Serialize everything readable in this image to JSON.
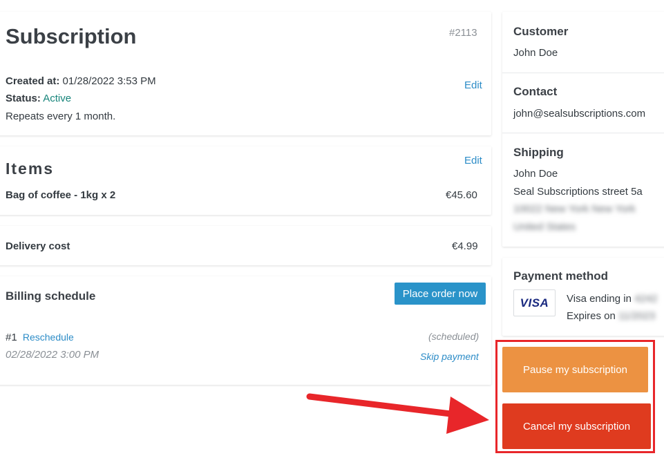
{
  "subscription": {
    "title": "Subscription",
    "number": "#2113",
    "created_label": "Created at:",
    "created_value": "01/28/2022 3:53 PM",
    "status_label": "Status:",
    "status_value": "Active",
    "repeats": "Repeats every 1 month.",
    "edit_label": "Edit"
  },
  "items": {
    "title": "Items",
    "edit_label": "Edit",
    "rows": [
      {
        "name": "Bag of coffee - 1kg x 2",
        "price": "€45.60"
      }
    ]
  },
  "delivery": {
    "label": "Delivery cost",
    "value": "€4.99"
  },
  "billing": {
    "title": "Billing schedule",
    "place_order_label": "Place order now",
    "entries": [
      {
        "index": "#1",
        "reschedule_label": "Reschedule",
        "state": "(scheduled)",
        "date": "02/28/2022 3:00 PM",
        "skip_label": "Skip payment"
      }
    ]
  },
  "customer": {
    "title": "Customer",
    "name": "John Doe"
  },
  "contact": {
    "title": "Contact",
    "email": "john@sealsubscriptions.com"
  },
  "shipping": {
    "title": "Shipping",
    "name": "John Doe",
    "street": "Seal Subscriptions street 5a",
    "city_line": "10022 New York New York",
    "country": "United States"
  },
  "payment": {
    "title": "Payment method",
    "brand": "VISA",
    "ending_label": "Visa ending in",
    "ending_value": "4242",
    "expires_label": "Expires on",
    "expires_value": "11/2023"
  },
  "actions": {
    "pause_label": "Pause my subscription",
    "cancel_label": "Cancel my subscription"
  },
  "colors": {
    "pause": "#ec9242",
    "cancel": "#df3b1f",
    "highlight": "#e8262a",
    "link": "#2c8cc7"
  }
}
